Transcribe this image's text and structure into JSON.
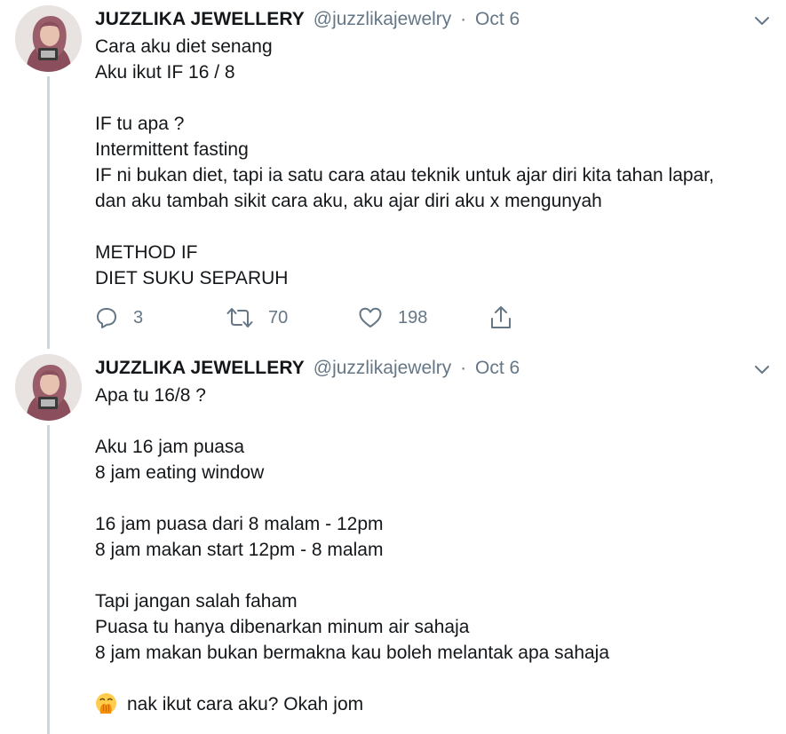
{
  "colors": {
    "text_primary": "#14171a",
    "text_secondary": "#657786",
    "thread_line": "#ccd6dd"
  },
  "tweets": [
    {
      "display_name": "JUZZLIKA JEWELLERY",
      "handle": "@juzzlikajewelry",
      "separator": "·",
      "date": "Oct 6",
      "lines": [
        "Cara aku diet senang",
        "Aku ikut IF 16 / 8",
        "",
        "IF tu apa ?",
        "Intermittent fasting",
        "IF ni bukan diet, tapi ia satu cara atau teknik untuk ajar diri kita tahan lapar,",
        "dan aku tambah sikit cara aku, aku ajar diri aku x mengunyah",
        "",
        "METHOD IF",
        "DIET SUKU SEPARUH"
      ],
      "replies": "3",
      "retweets": "70",
      "likes": "198",
      "icons": [
        "reply-icon",
        "retweet-icon",
        "like-icon",
        "share-icon",
        "chevron-down-icon"
      ]
    },
    {
      "display_name": "JUZZLIKA JEWELLERY",
      "handle": "@juzzlikajewelry",
      "separator": "·",
      "date": "Oct 6",
      "lines": [
        "Apa tu 16/8 ?",
        "",
        "Aku 16 jam puasa",
        "8 jam eating window",
        "",
        "16 jam puasa dari 8 malam - 12pm",
        "8 jam makan start 12pm - 8 malam",
        "",
        "Tapi jangan salah faham",
        "Puasa tu hanya dibenarkan minum air sahaja",
        "8 jam makan bukan bermakna kau boleh melantak apa sahaja",
        ""
      ],
      "last_line": "nak ikut cara aku? Okah jom",
      "last_line_emoji": "hand-over-mouth-emoji"
    }
  ]
}
